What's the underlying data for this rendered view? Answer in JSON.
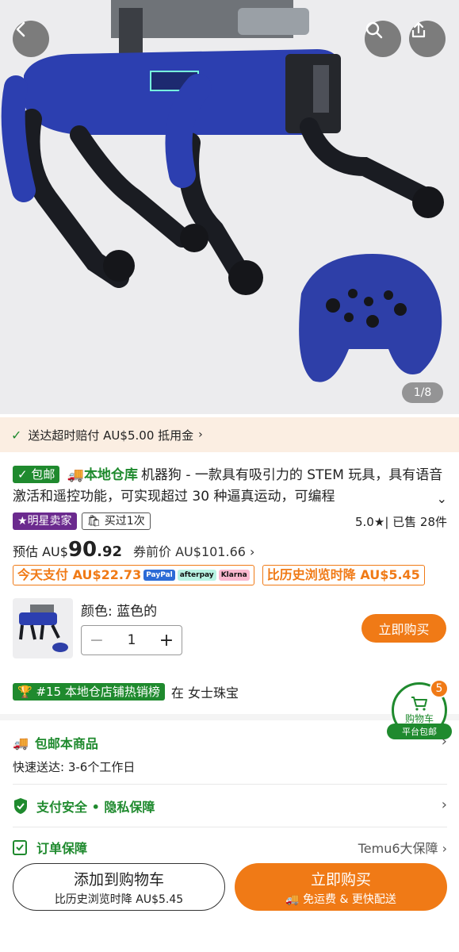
{
  "hero": {
    "image_counter": "1/8"
  },
  "promo": {
    "text": "送达超时赔付 AU$5.00 抵用金"
  },
  "product": {
    "free_ship_tag": "包邮",
    "local_warehouse": "本地仓库",
    "title": "机器狗 - 一款具有吸引力的 STEM 玩具，具有语音激活和遥控功能，可实现超过 30 种逼真运动，可编程",
    "star_seller": "明星卖家",
    "bought_before": "买过1次",
    "rating": "5.0★",
    "sold": "| 已售 28件"
  },
  "price": {
    "est_label": "预估 AU$",
    "integer": "90",
    "decimal": ".92",
    "before_coupon": "券前价 AU$101.66 ›"
  },
  "deals": {
    "pay_today": "今天支付 AU$22.73",
    "paypal": "PayPal",
    "afterpay": "afterpay",
    "klarna": "Klarna",
    "price_drop": "比历史浏览时降 AU$5.45"
  },
  "options": {
    "color": "颜色: 蓝色的",
    "quantity": "1",
    "buy_now": "立即购买"
  },
  "rank": {
    "tag": "#15 本地仓店铺热销榜",
    "category": "在 女士珠宝"
  },
  "cart": {
    "count": "5",
    "label": "购物车",
    "ship": "平台包邮"
  },
  "shipping": {
    "title": "包邮本商品",
    "subtitle": "快速送达: 3-6个工作日"
  },
  "security": {
    "title": "支付安全 • 隐私保障"
  },
  "order": {
    "title": "订单保障",
    "right": "Temu6大保障 ›"
  },
  "bottom": {
    "add_cart": "添加到购物车",
    "add_cart_sub": "比历史浏览时降 AU$5.45",
    "buy_now": "立即购买",
    "buy_now_sub": "免运费 & 更快配送"
  },
  "colors": {
    "accent": "#f07a16",
    "green": "#1f8a2e",
    "purple": "#6b2a8e"
  }
}
